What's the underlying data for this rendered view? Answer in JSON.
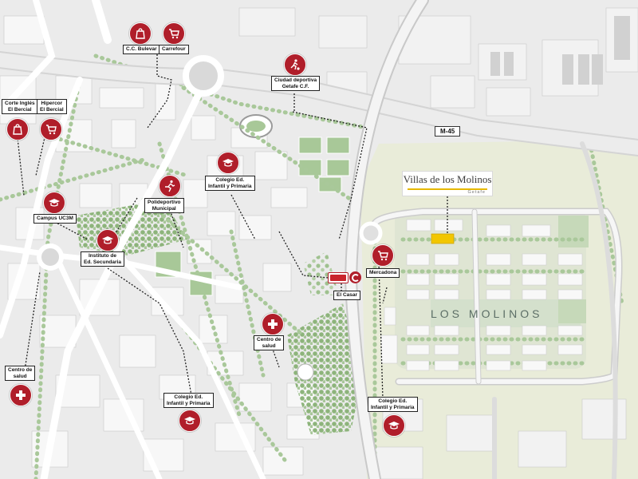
{
  "colors": {
    "poi": "#b01e2a",
    "background": "#ebebeb",
    "greenery": "#9fc18f",
    "dev_area": "#e9ecd9",
    "brand_bar": "#e6b800"
  },
  "road": {
    "label": "M-45"
  },
  "brand": {
    "title": "Villas de los Molinos",
    "subtitle": "Getafe"
  },
  "area": {
    "name": "LOS MOLINOS"
  },
  "pois": [
    {
      "label": "C.C. Bulevar",
      "icon": "shopping-bag-icon"
    },
    {
      "label": "Carrefour",
      "icon": "shopping-cart-icon"
    },
    {
      "label": "Ciudad deportiva\nGetafe C.F.",
      "icon": "football-icon"
    },
    {
      "label": "Corte Inglés\nEl Bercial",
      "icon": "shopping-bag-icon"
    },
    {
      "label": "Hipercor\nEl Bercial",
      "icon": "shopping-cart-icon"
    },
    {
      "label": "Campus UC3M",
      "icon": "graduation-cap-icon"
    },
    {
      "label": "Colegio Ed.\nInfantil y Primaria",
      "icon": "graduation-cap-icon"
    },
    {
      "label": "Polideportivo\nMunicipal",
      "icon": "runner-icon"
    },
    {
      "label": "Instituto de\nEd. Secundaria",
      "icon": "graduation-cap-icon"
    },
    {
      "label": "Mercadona",
      "icon": "shopping-cart-icon"
    },
    {
      "label": "Centro de\nsalud",
      "icon": "medical-cross-icon"
    },
    {
      "label": "Centro de\nsalud",
      "icon": "medical-cross-icon"
    },
    {
      "label": "Colegio Ed.\nInfantil y Primaria",
      "icon": "graduation-cap-icon"
    },
    {
      "label": "Colegio Ed.\nInfantil y Primaria",
      "icon": "graduation-cap-icon"
    }
  ],
  "transit": {
    "label": "El Casar",
    "icons": [
      "metro-icon",
      "renfe-icon"
    ]
  }
}
